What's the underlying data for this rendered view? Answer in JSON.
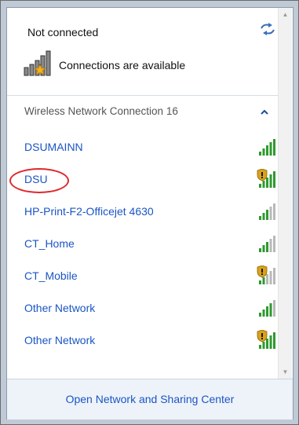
{
  "status": {
    "title": "Not connected",
    "connections_text": "Connections are available",
    "refresh_icon": "refresh-network-icon",
    "connections_icon": "network-star-icon"
  },
  "section": {
    "label": "Wireless Network Connection 16",
    "collapse_icon": "chevron-up-icon"
  },
  "networks": [
    {
      "name": "DSUMAINN",
      "secured": false,
      "highlighted": false
    },
    {
      "name": "DSU",
      "secured": true,
      "highlighted": true
    },
    {
      "name": "HP-Print-F2-Officejet 4630",
      "secured": false,
      "highlighted": false
    },
    {
      "name": "CT_Home",
      "secured": false,
      "highlighted": false
    },
    {
      "name": "CT_Mobile",
      "secured": true,
      "highlighted": false
    },
    {
      "name": "Other Network",
      "secured": false,
      "highlighted": false
    },
    {
      "name": "Other Network",
      "secured": true,
      "highlighted": false
    }
  ],
  "footer": {
    "link": "Open Network and Sharing Center"
  },
  "colors": {
    "link": "#1a55c4",
    "signal": "#2e9a2e",
    "signal_weak": "#b8b8b8",
    "highlight": "#e0282a",
    "shield": "#d9a21b"
  }
}
